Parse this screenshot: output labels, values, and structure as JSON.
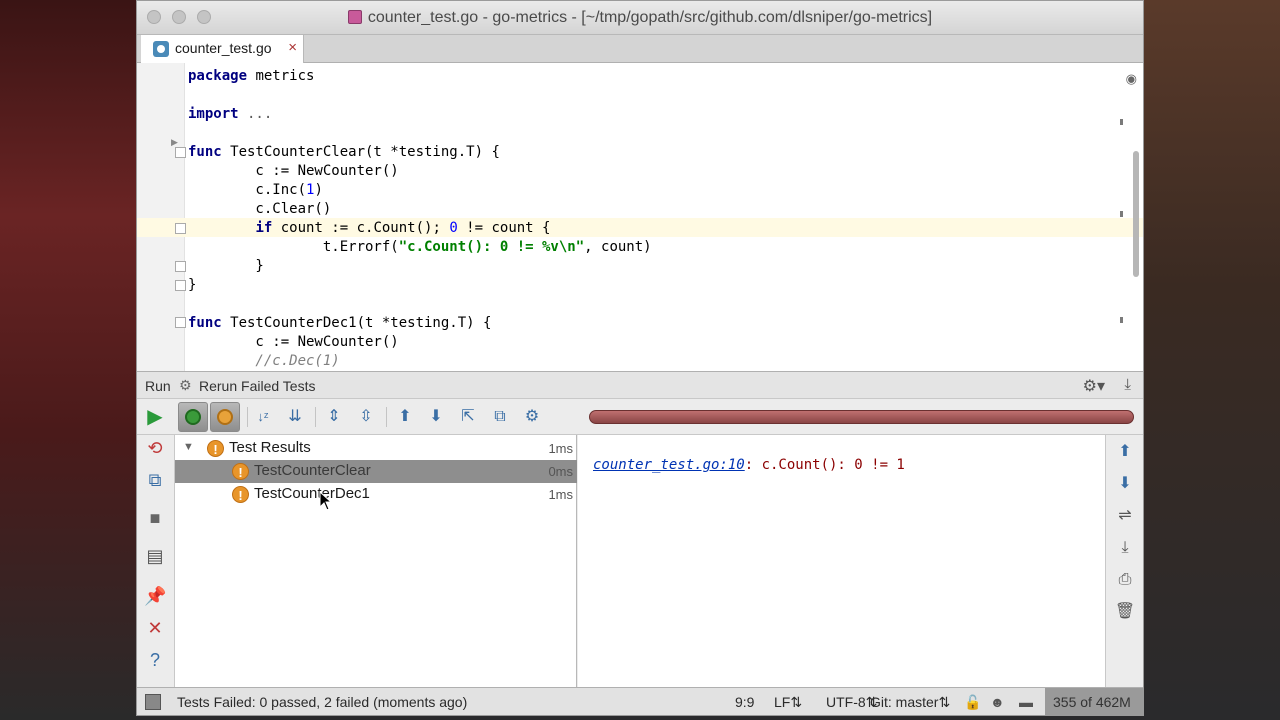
{
  "window": {
    "title": "counter_test.go - go-metrics - [~/tmp/gopath/src/github.com/dlsniper/go-metrics]"
  },
  "tabs": [
    {
      "label": "counter_test.go",
      "close": "×"
    }
  ],
  "editor": {
    "line_package_kw": "package",
    "line_package_name": " metrics",
    "line_import_kw": "import",
    "line_import_rest": " ...",
    "f1_kw": "func",
    "f1_sig": " TestCounterClear(t *testing.T) {",
    "f1_l1": "        c := NewCounter()",
    "f1_l2a": "        c.Inc(",
    "f1_l2n": "1",
    "f1_l2b": ")",
    "f1_l3": "        c.Clear()",
    "f1_l4_indent": "        ",
    "f1_l4_kw": "if",
    "f1_l4a": " count := c.Count(); ",
    "f1_l4n": "0",
    "f1_l4b": " != count {",
    "f1_l5a": "                t.Errorf(",
    "f1_l5s": "\"c.Count(): 0 != %v\\n\"",
    "f1_l5b": ", count)",
    "f1_l6": "        }",
    "f1_l7": "}",
    "f2_kw": "func",
    "f2_sig": " TestCounterDec1(t *testing.T) {",
    "f2_l1": "        c := NewCounter()",
    "f2_l2": "        //c.Dec(1)"
  },
  "run_panel": {
    "label": "Run",
    "config": "Rerun Failed Tests"
  },
  "tests": {
    "root": {
      "label": "Test Results",
      "duration": "1ms"
    },
    "items": [
      {
        "label": "TestCounterClear",
        "duration": "0ms",
        "status": "failed"
      },
      {
        "label": "TestCounterDec1",
        "duration": "1ms",
        "status": "failed"
      }
    ]
  },
  "console": {
    "link": "counter_test.go:10",
    "message": ": c.Count(): 0 != 1"
  },
  "status_bar": {
    "message": "Tests Failed: 0 passed, 2 failed (moments ago)",
    "position": "9:9",
    "line_sep": "LF",
    "encoding": "UTF-8",
    "vcs": "Git: master",
    "memory": "355 of 462M"
  },
  "colors": {
    "failed": "#e8952a",
    "progress_fail": "#8a4545"
  }
}
